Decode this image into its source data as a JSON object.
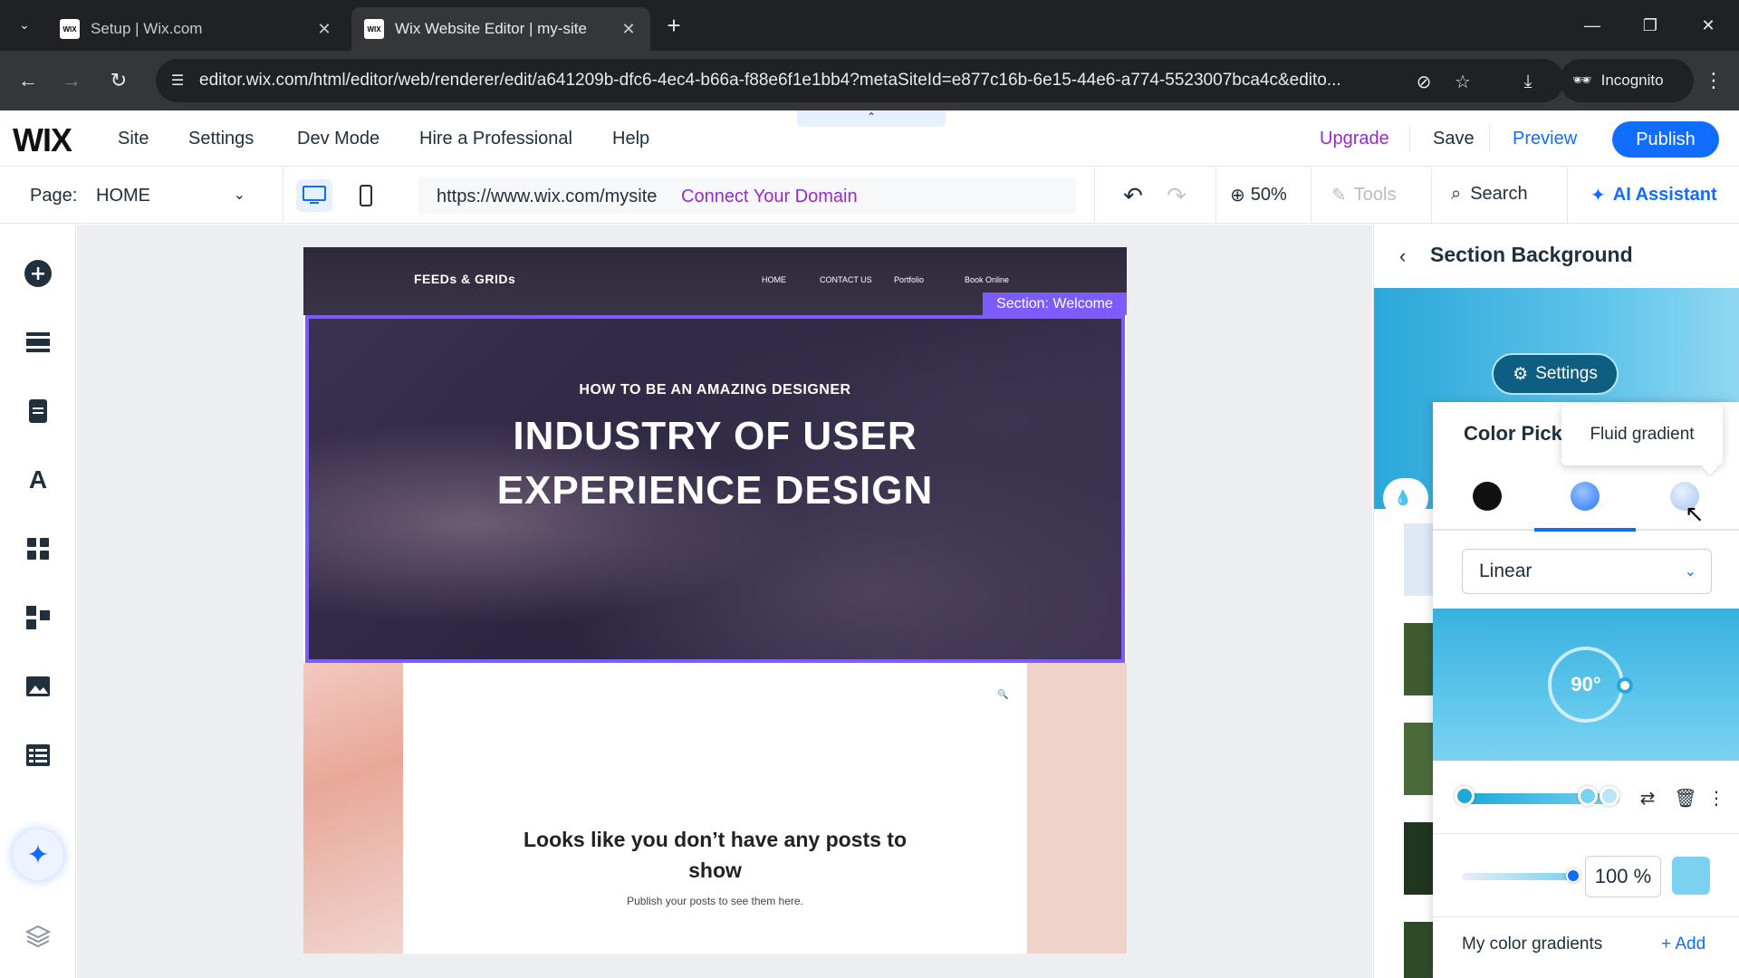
{
  "browser": {
    "tabs": [
      {
        "favicon": "WIX",
        "title": "Setup | Wix.com",
        "active": false
      },
      {
        "favicon": "WIX",
        "title": "Wix Website Editor | my-site",
        "active": true
      }
    ],
    "url": "editor.wix.com/html/editor/web/renderer/edit/a641209b-dfc6-4ec4-b66a-f88e6f1e1bb4?metaSiteId=e877c16b-6e15-44e6-a774-5523007bca4c&edito...",
    "incognito_label": "Incognito"
  },
  "wix_top": {
    "logo": "WIX",
    "menu": [
      "Site",
      "Settings",
      "Dev Mode",
      "Hire a Professional",
      "Help"
    ],
    "upgrade": "Upgrade",
    "save": "Save",
    "preview": "Preview",
    "publish": "Publish"
  },
  "toolbar": {
    "page_label": "Page:",
    "page_value": "HOME",
    "site_url": "https://www.wix.com/mysite",
    "connect_domain": "Connect Your Domain",
    "zoom": "50%",
    "tools": "Tools",
    "search": "Search",
    "ai_assistant": "AI Assistant"
  },
  "site": {
    "brand": "FEEDs & GRIDs",
    "nav": [
      "HOME",
      "CONTACT US",
      "Portfolio",
      "Book Online"
    ],
    "section_tag": "Section: Welcome",
    "hero_sub": "HOW TO BE AN AMAZING DESIGNER",
    "hero_title_1": "INDUSTRY OF USER",
    "hero_title_2": "EXPERIENCE DESIGN",
    "blog_empty_1": "Looks like you don’t have any posts to",
    "blog_empty_2": "show",
    "blog_hint": "Publish your posts to see them here."
  },
  "panel": {
    "title": "Section Background",
    "settings": "Settings",
    "picker_title": "Color Pick",
    "tooltip": "Fluid gradient",
    "gradient_type": "Linear",
    "angle": "90°",
    "opacity": "100 %",
    "my_gradients": "My color gradients",
    "add": "+ Add"
  },
  "colors": {
    "accent": "#116dff",
    "upgrade": "#9a27d5",
    "selection": "#7c5cff",
    "gradient_start": "#2aa7d9",
    "gradient_end": "#8fd7f1"
  }
}
